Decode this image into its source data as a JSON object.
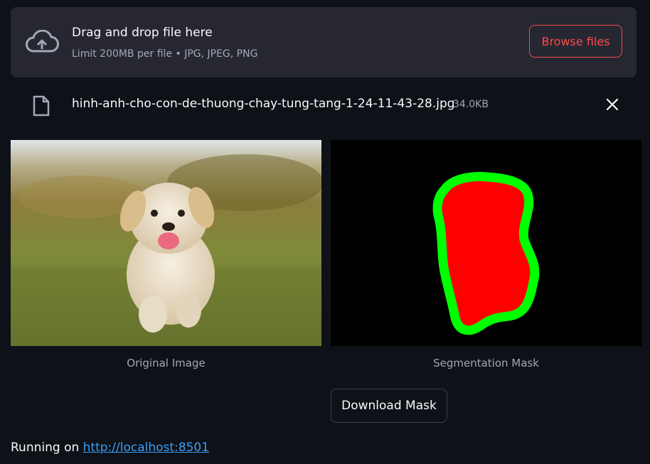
{
  "uploader": {
    "title": "Drag and drop file here",
    "subtitle": "Limit 200MB per file • JPG, JPEG, PNG",
    "browse_label": "Browse files",
    "icon": "cloud-upload-icon"
  },
  "file": {
    "name": "hinh-anh-cho-con-de-thuong-chay-tung-tang-1-24-11-43-28.jpg",
    "size": "34.0KB",
    "icon": "file-icon"
  },
  "images": {
    "original_caption": "Original Image",
    "mask_caption": "Segmentation Mask"
  },
  "download_label": "Download Mask",
  "footer": {
    "prefix": "Running on ",
    "link_text": "http://localhost:8501"
  },
  "colors": {
    "background": "#0e1117",
    "panel": "#262730",
    "accent": "#ff4b4b",
    "link": "#3d9df3",
    "mask_fill": "#ff0000",
    "mask_outline": "#00ff00"
  }
}
